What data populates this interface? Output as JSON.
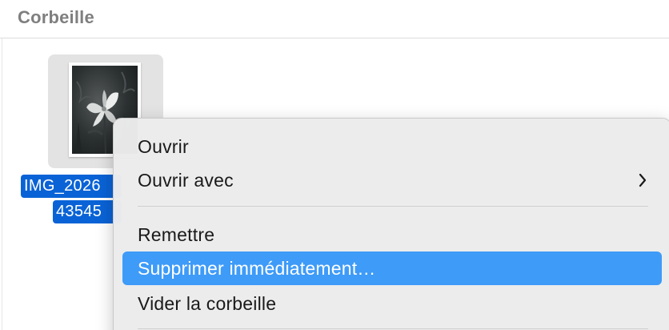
{
  "header": {
    "title": "Corbeille"
  },
  "file": {
    "name_line1": "IMG_2026",
    "name_line2": "43545"
  },
  "context_menu": {
    "items": [
      {
        "label": "Ouvrir"
      },
      {
        "label": "Ouvrir avec",
        "submenu_icon": "chevron-right-icon"
      },
      {
        "label": "Remettre"
      },
      {
        "label": "Supprimer immédiatement…",
        "highlighted": true
      },
      {
        "label": "Vider la corbeille"
      }
    ]
  },
  "colors": {
    "selection_blue": "#0a63d6",
    "menu_highlight": "#3e9bf8",
    "header_text": "#7f7f7f"
  }
}
